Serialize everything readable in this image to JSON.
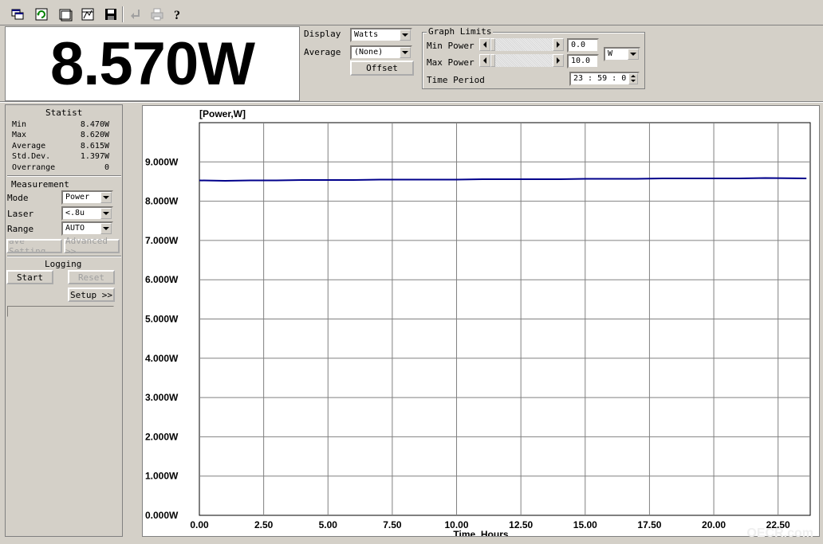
{
  "toolbar": {
    "buttons": [
      {
        "icon": "open-window-icon"
      },
      {
        "icon": "refresh-icon"
      },
      {
        "icon": "window-icon"
      },
      {
        "icon": "chart-settings-icon"
      },
      {
        "icon": "save-icon"
      },
      {
        "icon": "enter-icon",
        "disabled": true
      },
      {
        "icon": "print-icon",
        "disabled": true
      },
      {
        "icon": "help-icon"
      }
    ]
  },
  "readout": {
    "value": "8.570W"
  },
  "display": {
    "display_label": "Display",
    "display_value": "Watts",
    "average_label": "Average",
    "average_value": "(None)",
    "offset_label": "Offset"
  },
  "graph_limits": {
    "title": "Graph Limits",
    "min_power_label": "Min Power",
    "min_power_value": "0.0",
    "max_power_label": "Max Power",
    "max_power_value": "10.0",
    "unit_value": "W",
    "time_period_label": "Time Period",
    "time_period_value": "23 : 59 : 0"
  },
  "statistics": {
    "title": "Statist",
    "rows": [
      {
        "label": "Min",
        "value": "8.470W"
      },
      {
        "label": "Max",
        "value": "8.620W"
      },
      {
        "label": "Average",
        "value": "8.615W"
      },
      {
        "label": "Std.Dev.",
        "value": "1.397W"
      },
      {
        "label": "Overrange",
        "value": "0"
      }
    ]
  },
  "measurement": {
    "title": "Measurement",
    "mode_label": "Mode",
    "mode_value": "Power",
    "laser_label": "Laser",
    "laser_value": "<.8u",
    "range_label": "Range",
    "range_value": "AUTO",
    "save_settings_label": "ave Setting",
    "advanced_label": "Advanced >>"
  },
  "logging": {
    "title": "Logging",
    "start_label": "Start",
    "reset_label": "Reset",
    "setup_label": "Setup >>",
    "progress": 0
  },
  "chart_data": {
    "type": "line",
    "title": "[Power,W]",
    "xlabel": "Time, Hours",
    "ylabel": "",
    "xlim": [
      0,
      23.75
    ],
    "ylim": [
      0,
      10
    ],
    "x_ticks": [
      "0.00",
      "2.50",
      "5.00",
      "7.50",
      "10.00",
      "12.50",
      "15.00",
      "17.50",
      "20.00",
      "22.50"
    ],
    "y_ticks": [
      "0.000W",
      "1.000W",
      "2.000W",
      "3.000W",
      "4.000W",
      "5.000W",
      "6.000W",
      "7.000W",
      "8.000W",
      "9.000W"
    ],
    "grid": true,
    "series": [
      {
        "color": "#00008b",
        "x": [
          0,
          1,
          2,
          3,
          4,
          5,
          6,
          7,
          8,
          9,
          10,
          11,
          12,
          13,
          14,
          15,
          16,
          17,
          18,
          19,
          20,
          21,
          22,
          23.6
        ],
        "y": [
          8.53,
          8.52,
          8.53,
          8.53,
          8.54,
          8.54,
          8.54,
          8.55,
          8.55,
          8.55,
          8.55,
          8.56,
          8.56,
          8.56,
          8.56,
          8.57,
          8.57,
          8.57,
          8.58,
          8.58,
          8.58,
          8.58,
          8.59,
          8.58
        ]
      }
    ]
  },
  "watermark": "OECR.com"
}
